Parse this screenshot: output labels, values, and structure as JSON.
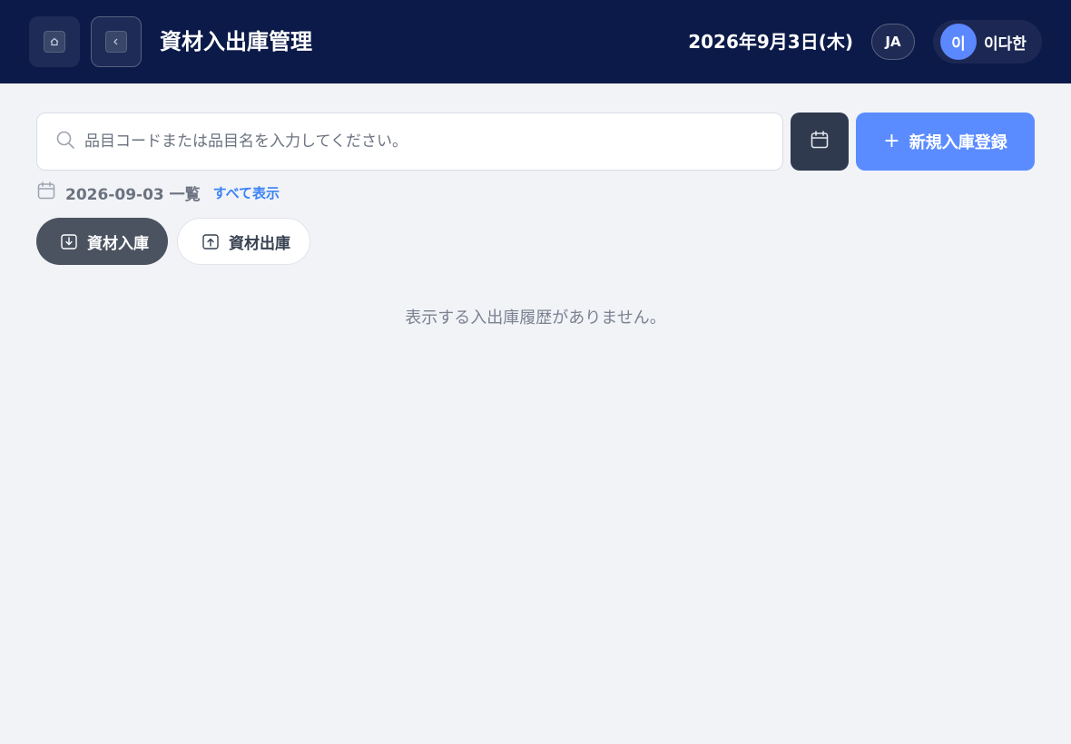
{
  "header": {
    "title": "資材入出庫管理",
    "date": "2026年9月3日(木)",
    "language": "JA",
    "user": {
      "avatar_initial": "이",
      "name": "이다한"
    },
    "home_icon": "home-icon",
    "back_icon": "chevron-left-icon"
  },
  "search": {
    "placeholder": "品目コードまたは品目名を入力してください。",
    "value": "",
    "icon": "search-icon"
  },
  "actions": {
    "calendar_icon": "calendar-icon",
    "new_button_label": "新規入庫登録"
  },
  "filter": {
    "date_label": "2026-09-03 一覧",
    "show_all_label": "すべて表示"
  },
  "tabs": [
    {
      "label": "資材入庫",
      "icon": "inbound-icon",
      "active": true
    },
    {
      "label": "資材出庫",
      "icon": "outbound-icon",
      "active": false
    }
  ],
  "empty_message": "表示する入出庫履歴がありません。",
  "colors": {
    "header_bg": "#0b1a48",
    "accent": "#5b8cff",
    "page_bg": "#f1f3f7",
    "active_tab": "#4b5361",
    "link": "#3b82f6"
  }
}
